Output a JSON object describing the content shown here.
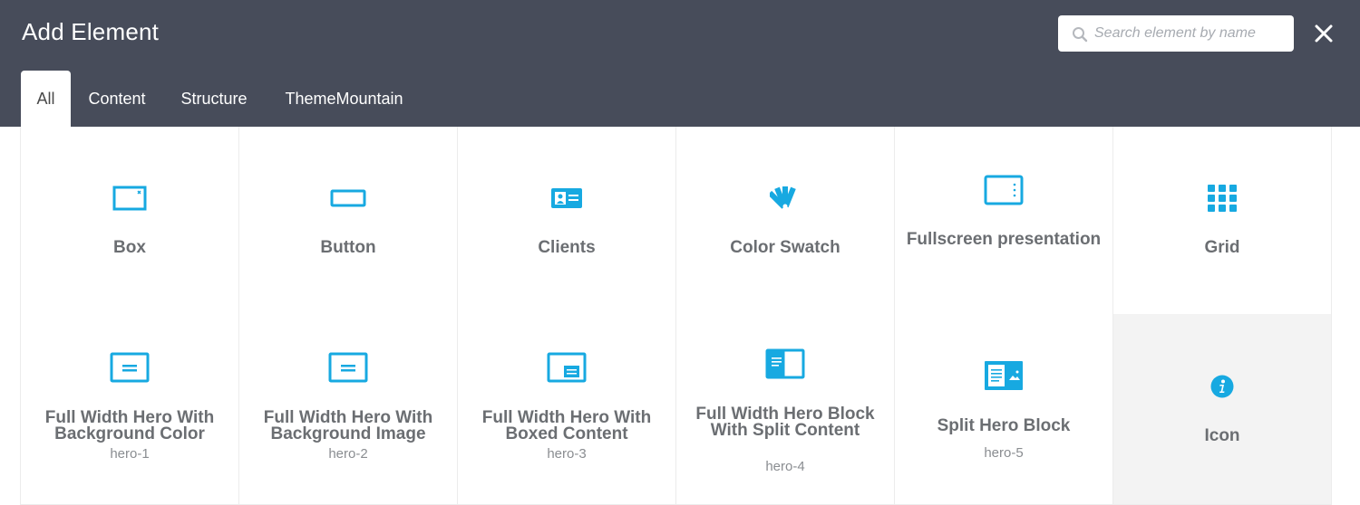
{
  "header": {
    "title": "Add Element",
    "close_label": "close"
  },
  "search": {
    "placeholder": "Search element by name",
    "value": ""
  },
  "tabs": [
    {
      "label": "All",
      "active": true
    },
    {
      "label": "Content",
      "active": false
    },
    {
      "label": "Structure",
      "active": false
    },
    {
      "label": "ThemeMountain",
      "active": false
    }
  ],
  "elements": [
    {
      "name": "Box",
      "id": "",
      "icon": "box-icon"
    },
    {
      "name": "Button",
      "id": "",
      "icon": "button-icon"
    },
    {
      "name": "Clients",
      "id": "",
      "icon": "clients-icon"
    },
    {
      "name": "Color Swatch",
      "id": "",
      "icon": "color-swatch-icon"
    },
    {
      "name": "Fullscreen presentation",
      "id": "",
      "icon": "fullscreen-presentation-icon"
    },
    {
      "name": "Grid",
      "id": "",
      "icon": "grid-icon"
    },
    {
      "name": "Full Width Hero With Background Color",
      "id": "hero-1",
      "icon": "hero-background-color-icon"
    },
    {
      "name": "Full Width Hero With Background Image",
      "id": "hero-2",
      "icon": "hero-background-image-icon"
    },
    {
      "name": "Full Width Hero With Boxed Content",
      "id": "hero-3",
      "icon": "hero-boxed-content-icon"
    },
    {
      "name": "Full Width Hero Block With Split Content",
      "id": "hero-4",
      "icon": "hero-split-content-icon"
    },
    {
      "name": "Split Hero Block",
      "id": "hero-5",
      "icon": "split-hero-block-icon"
    },
    {
      "name": "Icon",
      "id": "",
      "icon": "info-icon"
    }
  ],
  "colors": {
    "header_bg": "#474c5a",
    "accent": "#17a9e1",
    "label": "#6b6e72"
  }
}
